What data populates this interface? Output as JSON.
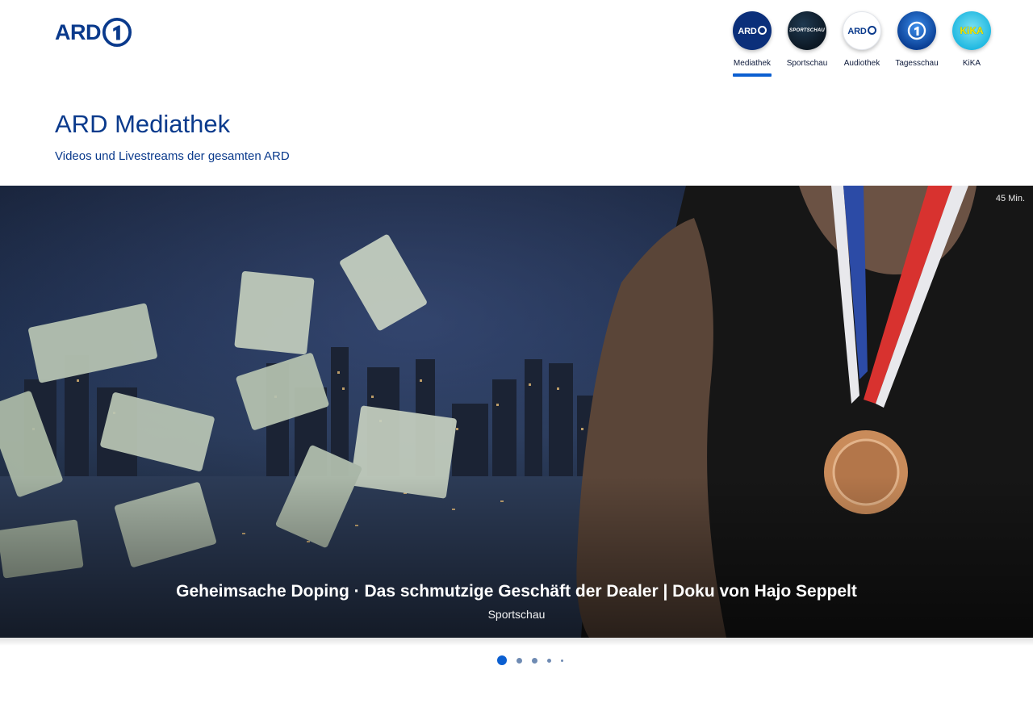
{
  "brand": {
    "logo_text": "ARD"
  },
  "channels": [
    {
      "label": "Mediathek",
      "icon": "ard-mediathek-icon",
      "active": true
    },
    {
      "label": "Sportschau",
      "icon": "sportschau-icon",
      "active": false,
      "badge": "SPORTSCHAU"
    },
    {
      "label": "Audiothek",
      "icon": "ard-audiothek-icon",
      "active": false
    },
    {
      "label": "Tagesschau",
      "icon": "tagesschau-icon",
      "active": false
    },
    {
      "label": "KiKA",
      "icon": "kika-icon",
      "active": false,
      "badge": "KiKA"
    }
  ],
  "page": {
    "title": "ARD Mediathek",
    "subtitle": "Videos und Livestreams der gesamten ARD"
  },
  "hero": {
    "duration": "45 Min.",
    "title": "Geheimsache Doping · Das schmutzige Geschäft der Dealer | Doku von Hajo Seppelt",
    "channel": "Sportschau"
  },
  "carousel": {
    "slide_count": 5,
    "active_index": 0
  },
  "colors": {
    "brand_blue": "#0a3a8c",
    "active_underline": "#0b5fd1",
    "dot_active": "#0b5fd1",
    "dot_inactive": "#6f8bb3"
  }
}
